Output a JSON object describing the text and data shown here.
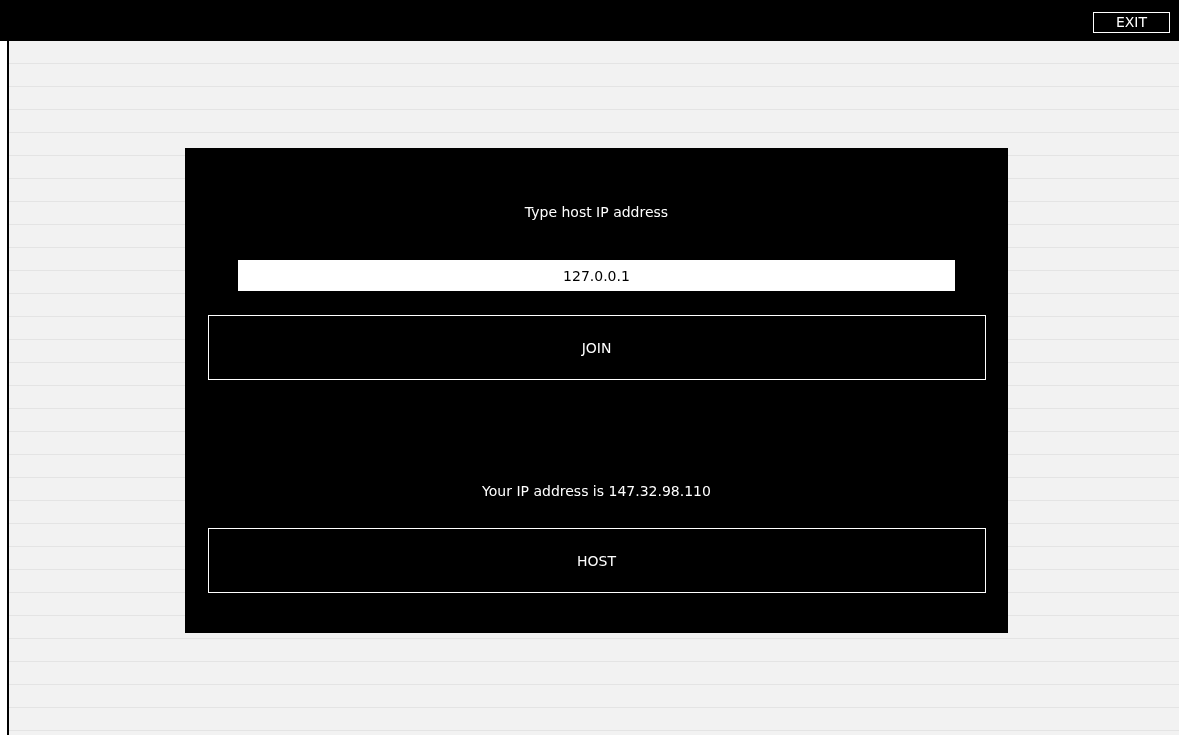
{
  "top_bar": {
    "exit_button": "EXIT"
  },
  "dialog": {
    "prompt": "Type host IP address",
    "ip_field": {
      "value": "127.0.0.1"
    },
    "join_button": "JOIN",
    "own_ip": "Your IP address is 147.32.98.110",
    "host_button": "HOST"
  }
}
